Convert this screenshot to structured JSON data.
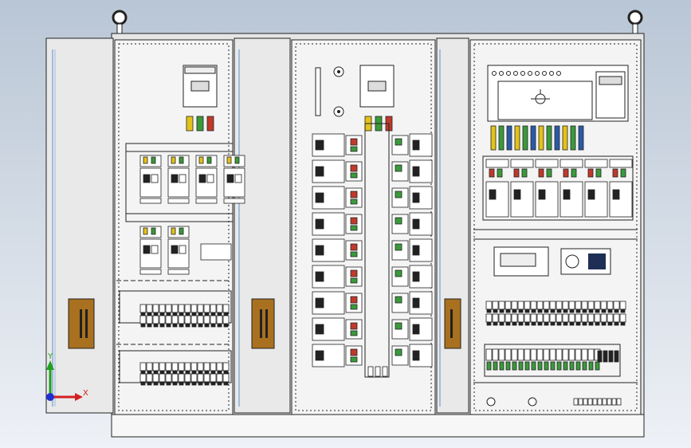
{
  "view": {
    "background_top": "#b9c6d5",
    "background_bottom": "#eef1f6",
    "panel_fill": "#f4f4f4",
    "frame_fill": "#e6e6e6",
    "door_fill": "#e9e9e9",
    "outline": "#222222",
    "handle_color": "#a8701f",
    "indicator_colors": {
      "phase_yellow": "#e3c21a",
      "phase_green": "#3a9a3a",
      "phase_red": "#c0392b",
      "phase_blue": "#2a5aa8"
    }
  },
  "axis_triad": {
    "x_label": "X",
    "y_label": "Y",
    "x_color": "#d42020",
    "y_color": "#20a020",
    "z_color": "#2030d0"
  },
  "sections": [
    {
      "name": "left-door",
      "type": "door"
    },
    {
      "name": "cabinet-1",
      "type": "distribution-panel",
      "main_breakers": 1,
      "branch_rows": 2
    },
    {
      "name": "middle-door",
      "type": "door"
    },
    {
      "name": "cabinet-2",
      "type": "breaker-rack",
      "breaker_rows": 9,
      "meters": 2
    },
    {
      "name": "right-door",
      "type": "door"
    },
    {
      "name": "cabinet-3",
      "type": "control-panel",
      "breaker_count": 6,
      "terminal_strips": 2
    }
  ]
}
